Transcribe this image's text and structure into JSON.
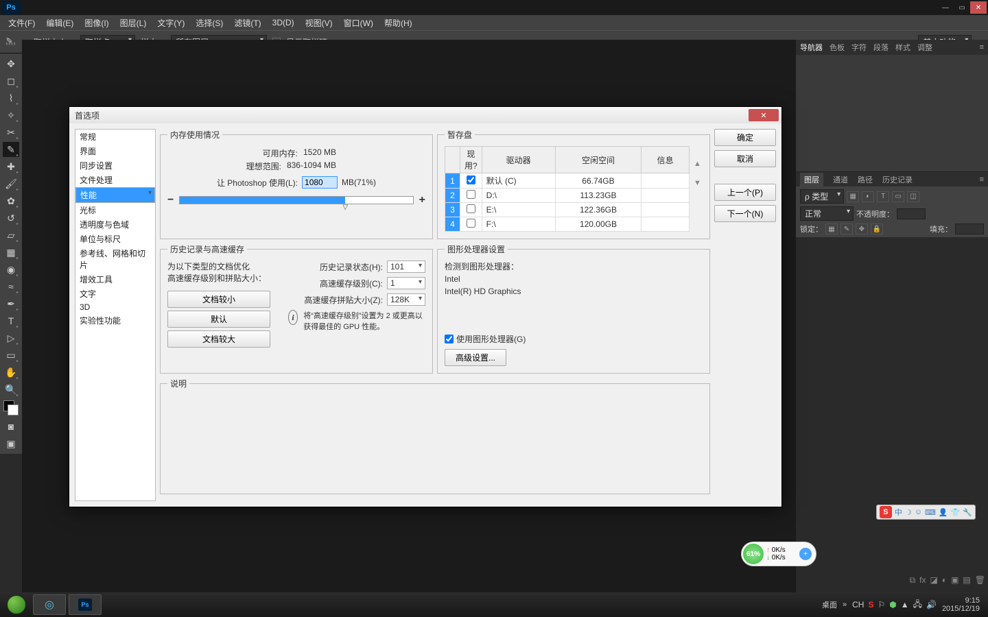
{
  "menu": [
    "文件(F)",
    "编辑(E)",
    "图像(I)",
    "图层(L)",
    "文字(Y)",
    "选择(S)",
    "滤镜(T)",
    "3D(D)",
    "视图(V)",
    "窗口(W)",
    "帮助(H)"
  ],
  "options": {
    "sample_label": "取样大小：",
    "sample_value": "取样点",
    "layers_label": "样本：",
    "layers_value": "所有图层",
    "ring_label": "显示取样环",
    "mode_label": "基本功能"
  },
  "right": {
    "top_tabs": [
      "导航器",
      "色板",
      "字符",
      "段落",
      "样式",
      "调整"
    ],
    "layer_tabs": [
      "图层",
      "通道",
      "路径",
      "历史记录"
    ],
    "kind_label": "ρ 类型",
    "blend": "正常",
    "opacity_label": "不透明度：",
    "lock_label": "锁定：",
    "fill_label": "填充："
  },
  "dialog": {
    "title": "首选项",
    "categories": [
      "常规",
      "界面",
      "同步设置",
      "文件处理",
      "性能",
      "光标",
      "透明度与色域",
      "单位与标尺",
      "参考线、网格和切片",
      "增效工具",
      "文字",
      "3D",
      "实验性功能"
    ],
    "selected_index": 4,
    "buttons": {
      "ok": "确定",
      "cancel": "取消",
      "prev": "上一个(P)",
      "next": "下一个(N)"
    },
    "memory": {
      "legend": "内存使用情况",
      "avail_label": "可用内存:",
      "avail_value": "1520 MB",
      "ideal_label": "理想范围:",
      "ideal_value": "836-1094 MB",
      "let_label": "让 Photoshop 使用(L):",
      "let_value": "1080",
      "let_pct": "MB(71%)"
    },
    "scratch": {
      "legend": "暂存盘",
      "headers": [
        "现用?",
        "驱动器",
        "空闲空间",
        "信息"
      ],
      "rows": [
        {
          "n": "1",
          "active": true,
          "drive": "默认 (C)",
          "free": "66.74GB",
          "info": ""
        },
        {
          "n": "2",
          "active": false,
          "drive": "D:\\",
          "free": "113.23GB",
          "info": ""
        },
        {
          "n": "3",
          "active": false,
          "drive": "E:\\",
          "free": "122.36GB",
          "info": ""
        },
        {
          "n": "4",
          "active": false,
          "drive": "F:\\",
          "free": "120.00GB",
          "info": ""
        }
      ]
    },
    "history": {
      "legend": "历史记录与高速缓存",
      "opt_text": "为以下类型的文档优化\n高速缓存级别和拼贴大小：",
      "btn_small": "文档较小",
      "btn_default": "默认",
      "btn_large": "文档较大",
      "states_label": "历史记录状态(H):",
      "states_value": "101",
      "cache_label": "高速缓存级别(C):",
      "cache_value": "1",
      "tile_label": "高速缓存拼贴大小(Z):",
      "tile_value": "128K",
      "hint": "将“高速缓存级别”设置为 2 或更高以获得最佳的 GPU 性能。"
    },
    "gpu": {
      "legend": "图形处理器设置",
      "detected_label": "检测到图形处理器：",
      "vendor": "Intel",
      "model": "Intel(R) HD Graphics",
      "use_label": "使用图形处理器(G)",
      "adv_btn": "高级设置..."
    },
    "desc_legend": "说明"
  },
  "taskbar": {
    "desktop": "桌面",
    "ch": "CH",
    "time": "9:15",
    "date": "2015/12/19"
  },
  "net": {
    "pct": "61%",
    "up": "0K/s",
    "down": "0K/s"
  },
  "ime": {
    "zhong": "中"
  }
}
